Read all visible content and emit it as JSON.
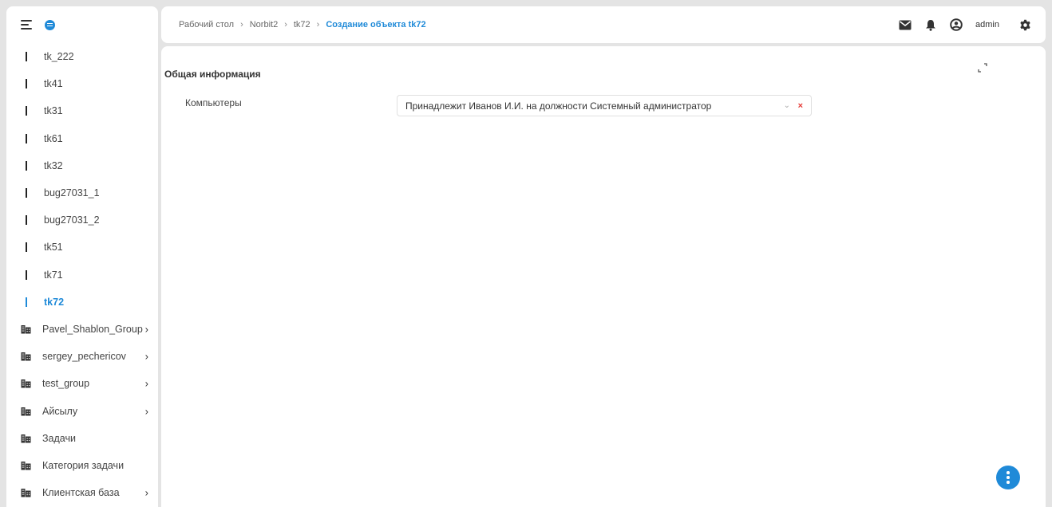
{
  "sidebar": {
    "items": [
      {
        "label": "tk_222",
        "kind": "object",
        "active": false,
        "chevron": false
      },
      {
        "label": "tk41",
        "kind": "object",
        "active": false,
        "chevron": false
      },
      {
        "label": "tk31",
        "kind": "object",
        "active": false,
        "chevron": false
      },
      {
        "label": "tk61",
        "kind": "object",
        "active": false,
        "chevron": false
      },
      {
        "label": "tk32",
        "kind": "object",
        "active": false,
        "chevron": false
      },
      {
        "label": "bug27031_1",
        "kind": "object",
        "active": false,
        "chevron": false
      },
      {
        "label": "bug27031_2",
        "kind": "object",
        "active": false,
        "chevron": false
      },
      {
        "label": "tk51",
        "kind": "object",
        "active": false,
        "chevron": false
      },
      {
        "label": "tk71",
        "kind": "object",
        "active": false,
        "chevron": false
      },
      {
        "label": "tk72",
        "kind": "object",
        "active": true,
        "chevron": false
      },
      {
        "label": "Pavel_Shablon_Group",
        "kind": "group",
        "active": false,
        "chevron": true
      },
      {
        "label": "sergey_pechericov",
        "kind": "group",
        "active": false,
        "chevron": true
      },
      {
        "label": "test_group",
        "kind": "group",
        "active": false,
        "chevron": true
      },
      {
        "label": "Айсылу",
        "kind": "group",
        "active": false,
        "chevron": true
      },
      {
        "label": "Задачи",
        "kind": "group",
        "active": false,
        "chevron": false
      },
      {
        "label": "Категория задачи",
        "kind": "group",
        "active": false,
        "chevron": false
      },
      {
        "label": "Клиентская база",
        "kind": "group",
        "active": false,
        "chevron": true
      }
    ]
  },
  "header": {
    "breadcrumbs": [
      "Рабочий стол",
      "Norbit2",
      "tk72"
    ],
    "current": "Создание объекта tk72",
    "user": "admin",
    "icons": [
      "mail-icon",
      "bell-icon",
      "user-icon",
      "gear-icon"
    ]
  },
  "main": {
    "section_title": "Общая информация",
    "field_label": "Компьютеры",
    "field_value": "Принадлежит Иванов И.И. на должности Системный администратор"
  },
  "colors": {
    "accent": "#1f8ad8",
    "background": "#e4e4e4",
    "clear": "#e53935"
  }
}
